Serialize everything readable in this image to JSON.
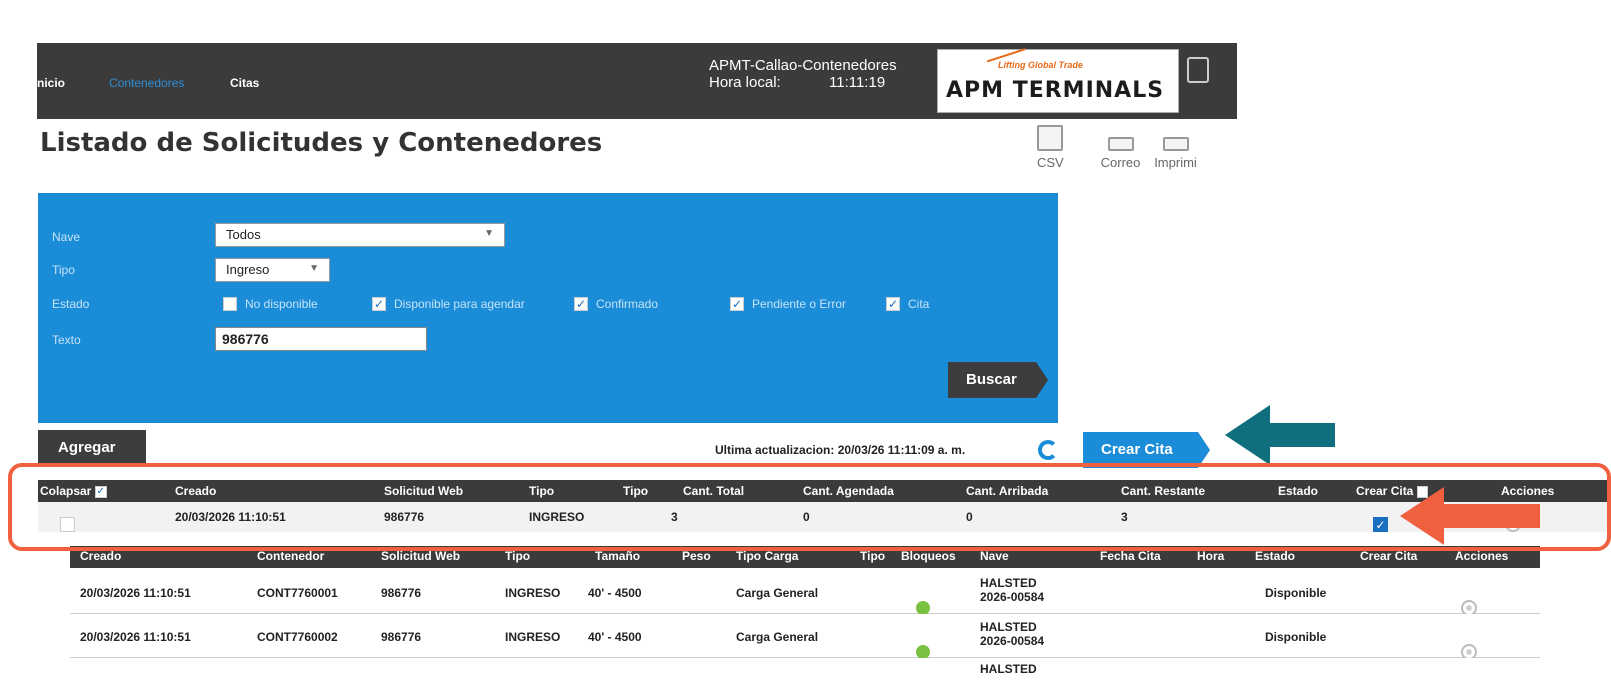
{
  "nav": {
    "items": [
      "nicio",
      "Contenedores",
      "Citas"
    ],
    "active": "Contenedores"
  },
  "header": {
    "site": "APMT-Callao-Contenedores",
    "local_time_label": "Hora local:",
    "local_time": "11:11:19",
    "logo_tagline": "Lifting Global Trade",
    "logo_name": "APM TERMINALS"
  },
  "page": {
    "title": "Listado de Solicitudes y Contenedores"
  },
  "toolbar": {
    "csv": "CSV",
    "email": "Correo",
    "print": "Imprimi"
  },
  "filters": {
    "nave_label": "Nave",
    "nave_value": "Todos",
    "tipo_label": "Tipo",
    "tipo_value": "Ingreso",
    "estado_label": "Estado",
    "estados": [
      {
        "label": "No disponible",
        "checked": false
      },
      {
        "label": "Disponible para agendar",
        "checked": true
      },
      {
        "label": "Confirmado",
        "checked": true
      },
      {
        "label": "Pendiente o Error",
        "checked": true
      },
      {
        "label": "Cita",
        "checked": true
      }
    ],
    "texto_label": "Texto",
    "texto_value": "986776",
    "search_button": "Buscar"
  },
  "actions": {
    "add_button": "Agregar",
    "last_update_label": "Ultima actualizacion:",
    "last_update": "20/03/26 11:11:09 a. m.",
    "create_button": "Crear Cita"
  },
  "table": {
    "headers": [
      "Colapsar",
      "Creado",
      "Solicitud Web",
      "Tipo",
      "Tipo",
      "Cant. Total",
      "Cant. Agendada",
      "Cant. Arribada",
      "Cant. Restante",
      "Estado",
      "Crear Cita",
      "Acciones"
    ],
    "group_row": {
      "creado": "20/03/2026 11:10:51",
      "solicitud": "986776",
      "tipo": "INGRESO",
      "total": "3",
      "agendada": "0",
      "arribada": "0",
      "restante": "3"
    },
    "detail_headers": [
      "Creado",
      "Contenedor",
      "Solicitud Web",
      "Tipo",
      "Tamaño",
      "Peso",
      "Tipo Carga",
      "Tipo",
      "Bloqueos",
      "Nave",
      "Fecha Cita",
      "Hora",
      "Estado",
      "Crear Cita",
      "Acciones"
    ],
    "rows": [
      {
        "creado": "20/03/2026 11:10:51",
        "contenedor": "CONT7760001",
        "solicitud": "986776",
        "tipo": "INGRESO",
        "tamano": "40' - 4500",
        "carga": "Carga General",
        "nave1": "HALSTED",
        "nave2": "2026-00584",
        "estado": "Disponible"
      },
      {
        "creado": "20/03/2026 11:10:51",
        "contenedor": "CONT7760002",
        "solicitud": "986776",
        "tipo": "INGRESO",
        "tamano": "40' - 4500",
        "carga": "Carga General",
        "nave1": "HALSTED",
        "nave2": "2026-00584",
        "estado": "Disponible"
      }
    ],
    "partial_row_nave": "HALSTED"
  },
  "colors": {
    "panel_blue": "#1a8cd8",
    "dark": "#3b3b3b",
    "highlight": "#f0603f",
    "teal_arrow": "#0f6f7f",
    "status_green": "#7ac142"
  }
}
